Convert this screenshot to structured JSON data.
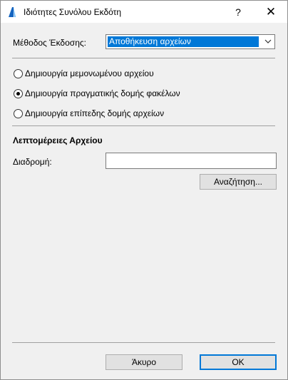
{
  "window": {
    "title": "Ιδιότητες Συνόλου Εκδότη",
    "help_label": "?",
    "close_label": "✕"
  },
  "method": {
    "label": "Μέθοδος Έκδοσης:",
    "selected": "Αποθήκευση αρχείων"
  },
  "radios": [
    {
      "label": "Δημιουργία μεμονωμένου αρχείου",
      "checked": false
    },
    {
      "label": "Δημιουργία πραγματικής δομής φακέλων",
      "checked": true
    },
    {
      "label": "Δημιουργία επίπεδης δομής αρχείων",
      "checked": false
    }
  ],
  "file_details": {
    "heading": "Λεπτομέρειες Αρχείου",
    "path_label": "Διαδρομή:",
    "path_value": "",
    "browse_label": "Αναζήτηση..."
  },
  "footer": {
    "cancel_label": "Άκυρο",
    "ok_label": "OK"
  }
}
